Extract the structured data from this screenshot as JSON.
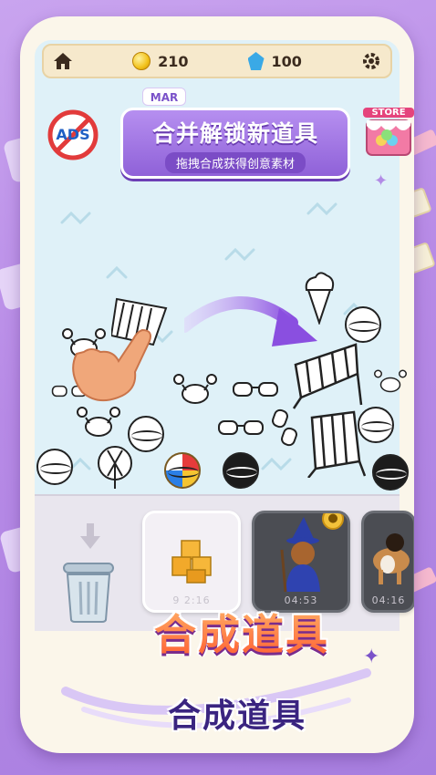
{
  "topbar": {
    "coins": "210",
    "gems": "100"
  },
  "banner": {
    "tag": "MAR",
    "title": "合并解锁新道具",
    "subtitle": "拖拽合成获得创意素材"
  },
  "badges": {
    "no_ads": "ADS",
    "store": "STORE"
  },
  "tray": {
    "slots": [
      {
        "time": "9 2:16",
        "locked": false
      },
      {
        "time": "04:53",
        "locked": true
      },
      {
        "time": "04:16",
        "locked": false
      }
    ]
  },
  "headline": "合成道具",
  "subheadline": "合成道具",
  "colors": {
    "banner": "#9b6ee0",
    "background": "#b78ae6",
    "headline": "#ff6a33"
  }
}
